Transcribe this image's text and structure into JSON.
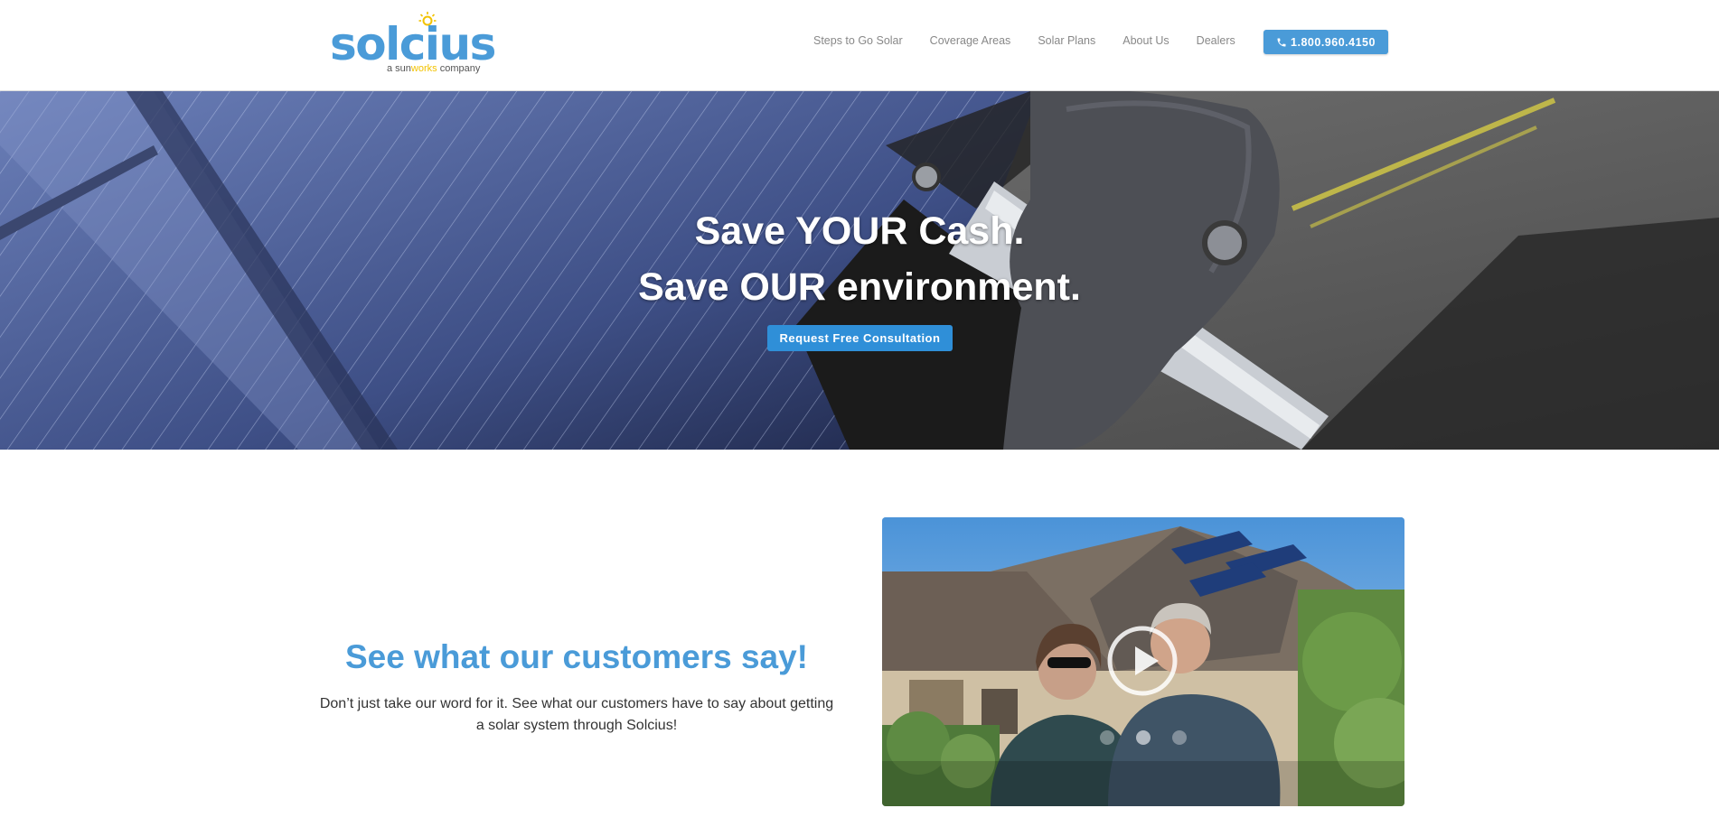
{
  "brand": {
    "name": "solcius",
    "tagline_prefix": "a sun",
    "tagline_highlight": "works",
    "tagline_suffix": " company",
    "primary_color": "#4a9bd8",
    "accent_color": "#f2c200"
  },
  "nav": {
    "items": [
      {
        "label": "Steps to Go Solar"
      },
      {
        "label": "Coverage Areas"
      },
      {
        "label": "Solar Plans"
      },
      {
        "label": "About Us"
      },
      {
        "label": "Dealers"
      }
    ],
    "phone": "1.800.960.4150",
    "phone_icon": "phone-icon"
  },
  "hero": {
    "line1": "Save YOUR Cash.",
    "line2": "Save OUR environment.",
    "cta": "Request Free Consultation"
  },
  "testimonials": {
    "title": "See what our customers say!",
    "text": "Don’t just take our word for it. See what our customers have to say about getting a solar system through Solcius!",
    "video": {
      "play_icon": "play-icon",
      "slides": 3,
      "active_slide": 2
    }
  }
}
